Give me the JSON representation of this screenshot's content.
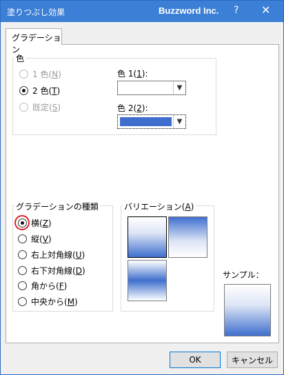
{
  "window": {
    "title": "塗りつぶし効果",
    "brand": "Buzzword Inc.",
    "help": "?",
    "close": "✕"
  },
  "tabs": {
    "gradient": "グラデーション"
  },
  "color_group": {
    "label": "色",
    "options": [
      {
        "label": "1 色(",
        "key": "N",
        "tail": ")",
        "checked": false,
        "disabled": true
      },
      {
        "label": "2 色(",
        "key": "T",
        "tail": ")",
        "checked": true,
        "disabled": false
      },
      {
        "label": "既定(",
        "key": "S",
        "tail": ")",
        "checked": false,
        "disabled": true
      }
    ],
    "color1": {
      "label": "色 1(",
      "key": "1",
      "tail": "):",
      "value_color": "#ffffff"
    },
    "color2": {
      "label": "色 2(",
      "key": "2",
      "tail": "):",
      "value_color": "#3f6fce"
    }
  },
  "gradient_type": {
    "label": "グラデーションの種類",
    "options": [
      {
        "label": "横(",
        "key": "Z",
        "tail": ")",
        "checked": true
      },
      {
        "label": "縦(",
        "key": "V",
        "tail": ")",
        "checked": false
      },
      {
        "label": "右上対角線(",
        "key": "U",
        "tail": ")",
        "checked": false
      },
      {
        "label": "右下対角線(",
        "key": "D",
        "tail": ")",
        "checked": false
      },
      {
        "label": "角から(",
        "key": "F",
        "tail": ")",
        "checked": false
      },
      {
        "label": "中央から(",
        "key": "M",
        "tail": ")",
        "checked": false
      }
    ]
  },
  "variation": {
    "label": "バリエーション(",
    "key": "A",
    "tail": ")"
  },
  "sample": {
    "label": "サンプル："
  },
  "buttons": {
    "ok": "OK",
    "cancel": "キャンセル"
  },
  "colors": {
    "titlebar": "#3c7fd6",
    "gradient_blue": "#3f6fce",
    "highlight_ring": "#e0202a"
  }
}
